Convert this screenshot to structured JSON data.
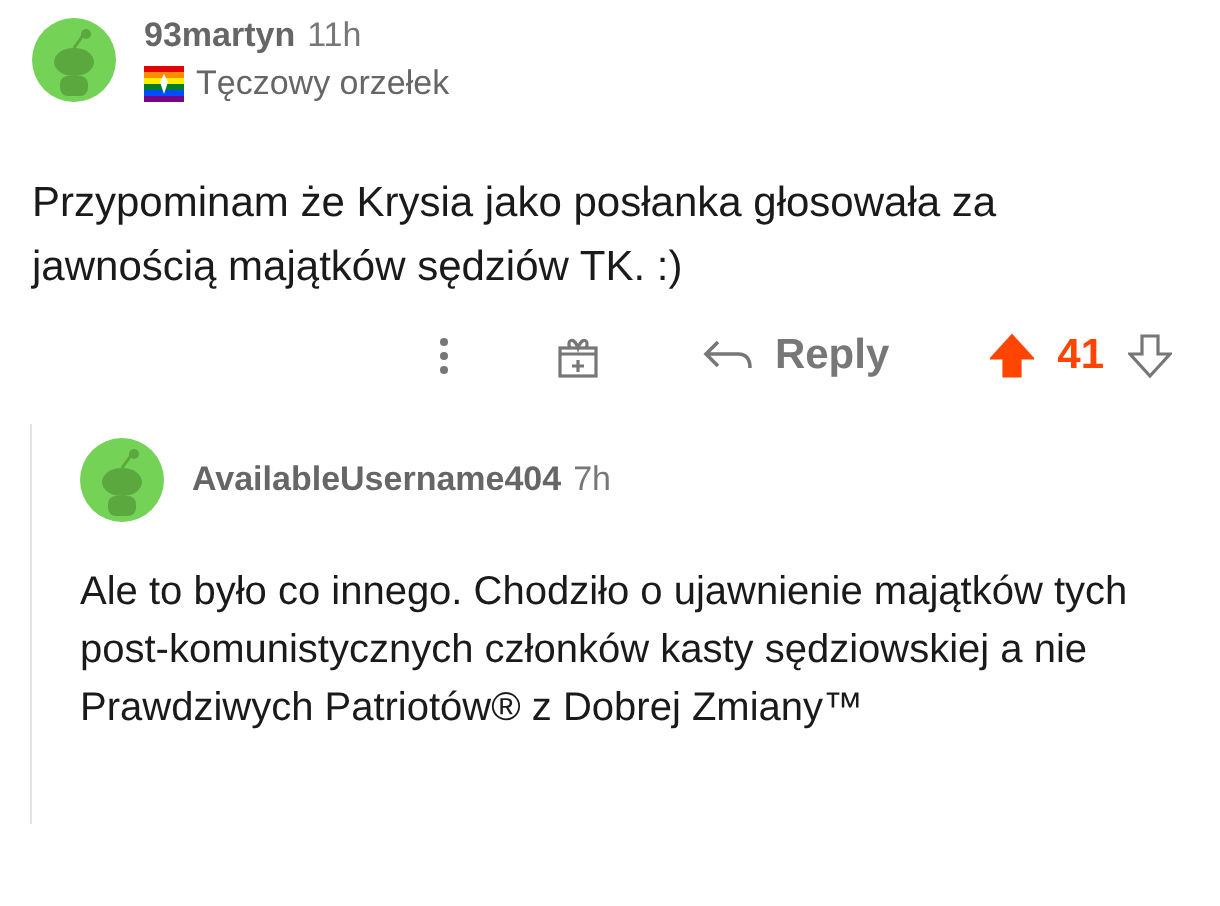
{
  "comment": {
    "author": "93martyn",
    "time": "11h",
    "flair": "Tęczowy orzełek",
    "body": "Przypominam że Krysia jako posłanka głosowała za jawnością majątków sędziów TK. :)",
    "actions": {
      "reply": "Reply",
      "score": "41",
      "upvoted": true,
      "downvoted": false
    }
  },
  "reply": {
    "author": "AvailableUsername404",
    "time": "7h",
    "body": "Ale to było co innego. Chodziło o ujawnienie majątków tych post-komunistycznych członków kasty sędziowskiej a nie Prawdziwych Patriotów® z Dobrej Zmiany™"
  }
}
